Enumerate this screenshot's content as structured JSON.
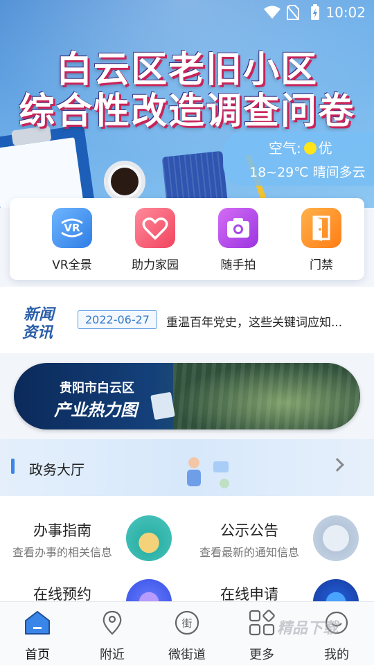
{
  "status_bar": {
    "time": "10:02"
  },
  "banner": {
    "title_line1": "白云区老旧小区",
    "title_line2": "综合性改造调查问卷"
  },
  "weather": {
    "air_label": "空气:",
    "air_quality": "优",
    "temperature": "18~29℃ 晴间多云"
  },
  "quick_actions": [
    {
      "label": "VR全景",
      "icon": "vr-icon"
    },
    {
      "label": "助力家园",
      "icon": "heart-icon"
    },
    {
      "label": "随手拍",
      "icon": "camera-icon"
    },
    {
      "label": "门禁",
      "icon": "door-icon"
    }
  ],
  "news": {
    "logo_line1": "新闻",
    "logo_line2": "资讯",
    "date": "2022-06-27",
    "headline": "重温百年党史，这些关键词应知..."
  },
  "industry_banner": {
    "line1": "贵阳市白云区",
    "line2": "产业热力图"
  },
  "service_hall": {
    "title": "政务大厅"
  },
  "services": [
    {
      "name": "办事指南",
      "desc": "查看办事的相关信息"
    },
    {
      "name": "公示公告",
      "desc": "查看最新的通知信息"
    },
    {
      "name": "在线预约",
      "desc": ""
    },
    {
      "name": "在线申请",
      "desc": ""
    }
  ],
  "tabs": [
    {
      "label": "首页",
      "icon": "home-icon",
      "active": true
    },
    {
      "label": "附近",
      "icon": "location-pin-icon",
      "active": false
    },
    {
      "label": "微街道",
      "icon": "street-icon",
      "active": false
    },
    {
      "label": "更多",
      "icon": "grid-icon",
      "active": false
    },
    {
      "label": "我的",
      "icon": "profile-icon",
      "active": false
    }
  ],
  "watermark": "精品下载",
  "colors": {
    "accent": "#3a86e8",
    "banner_bg": "#6fb0ea"
  }
}
